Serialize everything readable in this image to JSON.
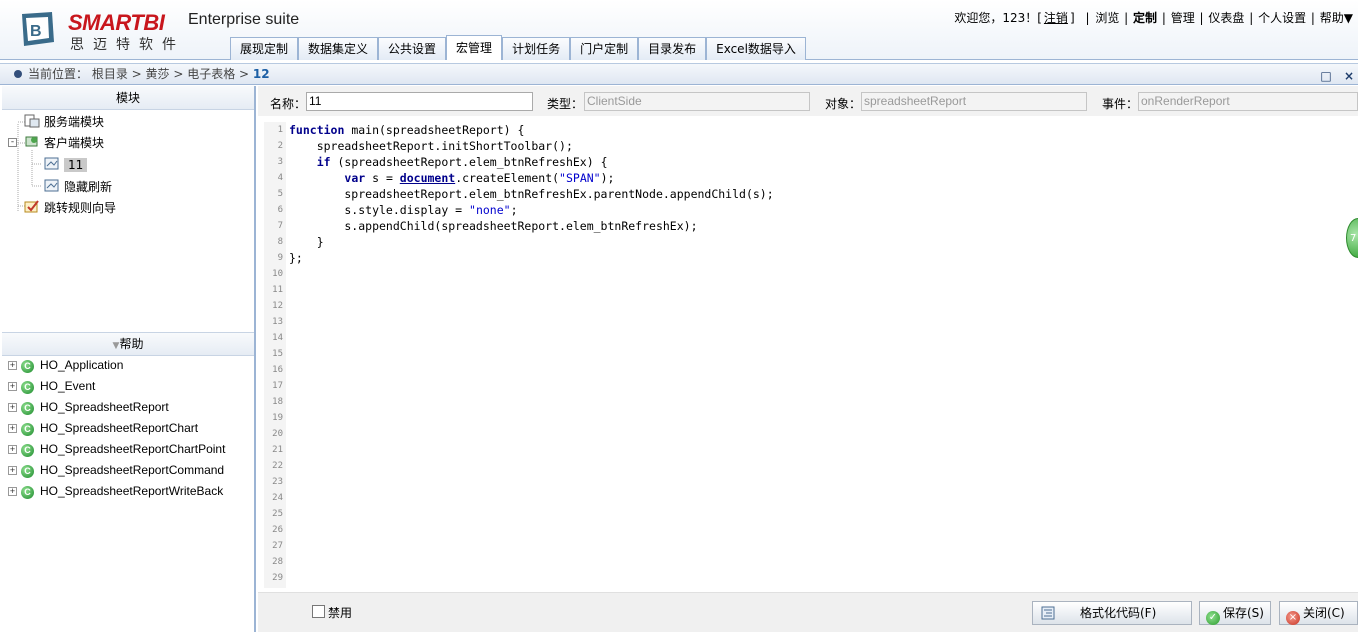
{
  "header": {
    "brand": "SMARTBI",
    "brand_sub": "思迈特软件",
    "suite": "Enterprise suite",
    "welcome": "欢迎您，123！[",
    "logout": "注销",
    "welcome_end": "]",
    "nav": [
      "浏览",
      "定制",
      "管理",
      "仪表盘",
      "个人设置",
      "帮助▼"
    ],
    "tabs": [
      {
        "label": "展现定制",
        "active": false
      },
      {
        "label": "数据集定义",
        "active": false
      },
      {
        "label": "公共设置",
        "active": false
      },
      {
        "label": "宏管理",
        "active": true
      },
      {
        "label": "计划任务",
        "active": false
      },
      {
        "label": "门户定制",
        "active": false
      },
      {
        "label": "目录发布",
        "active": false
      },
      {
        "label": "Excel数据导入",
        "active": false
      }
    ]
  },
  "breadcrumb": {
    "prefix": "当前位置：",
    "path": "根目录 > 黄莎 > 电子表格 >",
    "current": "12",
    "maximize": "□",
    "close": "×"
  },
  "left": {
    "module_title": "模块",
    "tree": {
      "server_module": "服务端模块",
      "client_module": "客户端模块",
      "client_children": [
        "11",
        "隐藏刷新"
      ],
      "redirect_wizard": "跳转规则向导"
    },
    "help_title": "帮助",
    "help_items": [
      "HO_Application",
      "HO_Event",
      "HO_SpreadsheetReport",
      "HO_SpreadsheetReportChart",
      "HO_SpreadsheetReportChartPoint",
      "HO_SpreadsheetReportCommand",
      "HO_SpreadsheetReportWriteBack"
    ]
  },
  "form": {
    "name_label": "名称：",
    "name_value": "11",
    "type_label": "类型：",
    "type_value": "ClientSide",
    "object_label": "对象：",
    "object_value": "spreadsheetReport",
    "event_label": "事件：",
    "event_value": "onRenderReport"
  },
  "editor": {
    "line_count": 29
  },
  "bottom": {
    "disable_label": "禁用",
    "format_button": "格式化代码(F)",
    "save_button": "保存(S)",
    "close_button": "关闭(C)"
  },
  "colors": {
    "accent_blue": "#9cb4d4",
    "brand_red": "#c8161d",
    "keyword": "#00008b",
    "string": "#0000cd"
  }
}
